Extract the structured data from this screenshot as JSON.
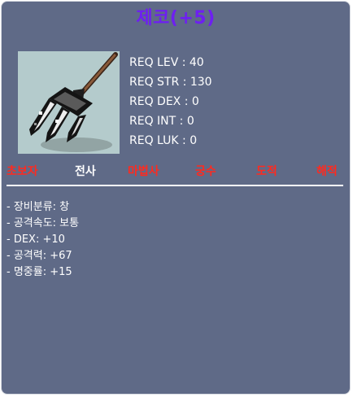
{
  "item": {
    "name": "제코(+5)",
    "image": "fork-spear-icon"
  },
  "requirements": [
    {
      "text": "REQ LEV : 40"
    },
    {
      "text": "REQ STR : 130"
    },
    {
      "text": "REQ DEX : 0"
    },
    {
      "text": "REQ INT : 0"
    },
    {
      "text": "REQ LUK : 0"
    }
  ],
  "jobs": [
    {
      "label": "초보자",
      "color": "#ff2a1f"
    },
    {
      "label": "전사",
      "color": "#ffffff"
    },
    {
      "label": "마법사",
      "color": "#ff2a1f"
    },
    {
      "label": "궁수",
      "color": "#ff2a1f"
    },
    {
      "label": "도적",
      "color": "#ff2a1f"
    },
    {
      "label": "해적",
      "color": "#ff2a1f"
    }
  ],
  "stats": [
    {
      "text": "- 장비분류: 창"
    },
    {
      "text": "- 공격속도: 보통"
    },
    {
      "text": "- DEX: +10"
    },
    {
      "text": "- 공격력: +67"
    },
    {
      "text": "- 명중률: +15"
    }
  ],
  "colors": {
    "panel": "#5f6a87",
    "title": "#6e1ff2",
    "unavailable_job": "#ff2a1f",
    "available_job": "#ffffff"
  }
}
